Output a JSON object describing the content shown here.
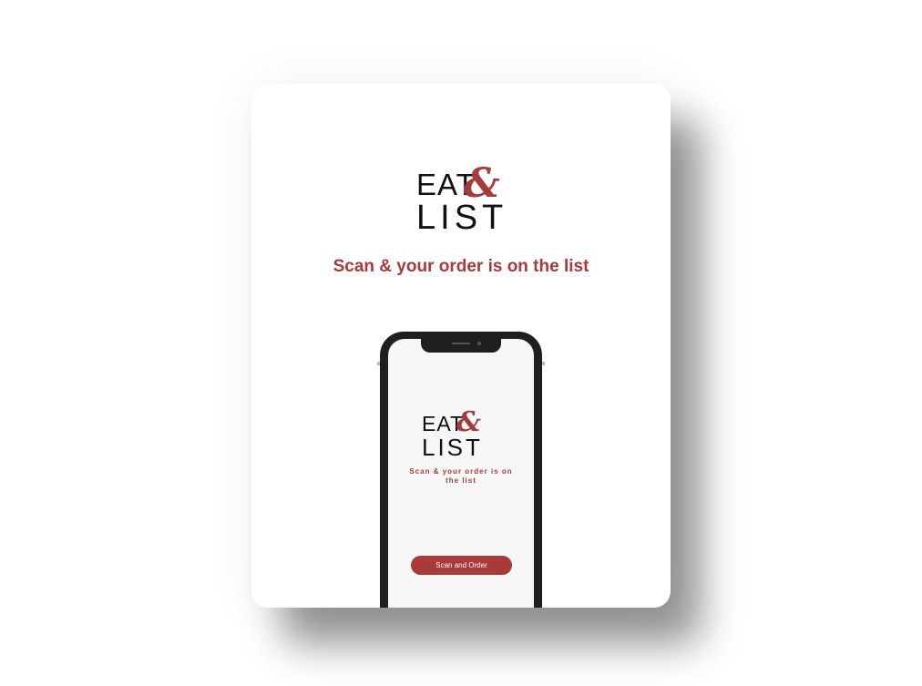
{
  "card": {
    "logo": {
      "line1": "EAT",
      "ampersand": "&",
      "line2": "LIST"
    },
    "tagline": "Scan & your order is on the list"
  },
  "phone": {
    "logo": {
      "line1": "EAT",
      "ampersand": "&",
      "line2": "LIST"
    },
    "tagline": "Scan & your order is on the list",
    "button_label": "Scan and Order"
  },
  "colors": {
    "accent": "#a83a3a",
    "text": "#111111",
    "phone_frame": "#1f1f1f",
    "screen_bg": "#f7f7f7"
  },
  "icons": [
    "logo-ampersand-icon",
    "phone-camera-icon",
    "phone-speaker-icon"
  ]
}
